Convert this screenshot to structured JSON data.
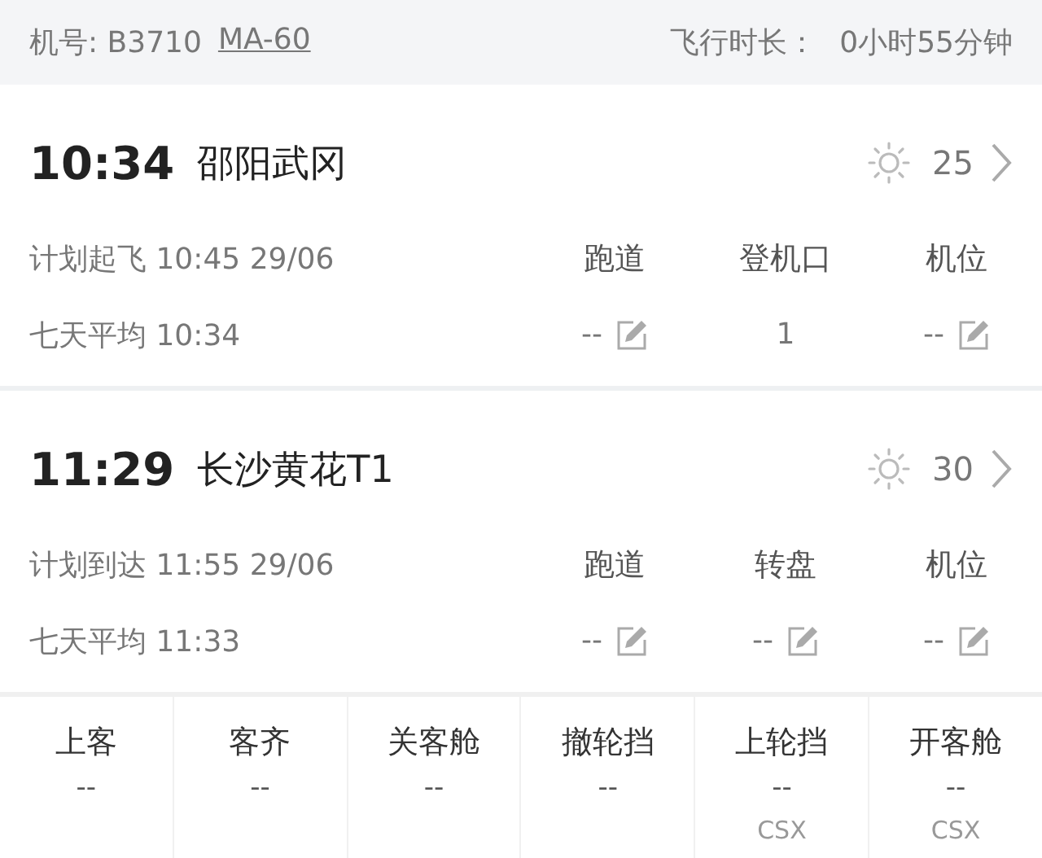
{
  "header": {
    "aircraft": "机号: B3710",
    "model": "MA-60",
    "duration_label": "飞行时长：",
    "duration": "0小时55分钟"
  },
  "segments": [
    {
      "time": "10:34",
      "airport": "邵阳武冈",
      "temperature": "25",
      "scheduled": "计划起飞 10:45 29/06",
      "average": "七天平均 10:34",
      "fields": [
        {
          "label": "跑道",
          "value": "--",
          "editable": true
        },
        {
          "label": "登机口",
          "value": "1",
          "editable": false
        },
        {
          "label": "机位",
          "value": "--",
          "editable": true
        }
      ]
    },
    {
      "time": "11:29",
      "airport": "长沙黄花T1",
      "temperature": "30",
      "scheduled": "计划到达 11:55 29/06",
      "average": "七天平均 11:33",
      "fields": [
        {
          "label": "跑道",
          "value": "--",
          "editable": true
        },
        {
          "label": "转盘",
          "value": "--",
          "editable": true
        },
        {
          "label": "机位",
          "value": "--",
          "editable": true
        }
      ]
    }
  ],
  "milestones": [
    {
      "label": "上客",
      "value": "--"
    },
    {
      "label": "客齐",
      "value": "--"
    },
    {
      "label": "关客舱",
      "value": "--"
    },
    {
      "label": "撤轮挡",
      "value": "--"
    },
    {
      "label": "上轮挡",
      "value": "--",
      "station": "CSX"
    },
    {
      "label": "开客舱",
      "value": "--",
      "station": "CSX"
    }
  ]
}
